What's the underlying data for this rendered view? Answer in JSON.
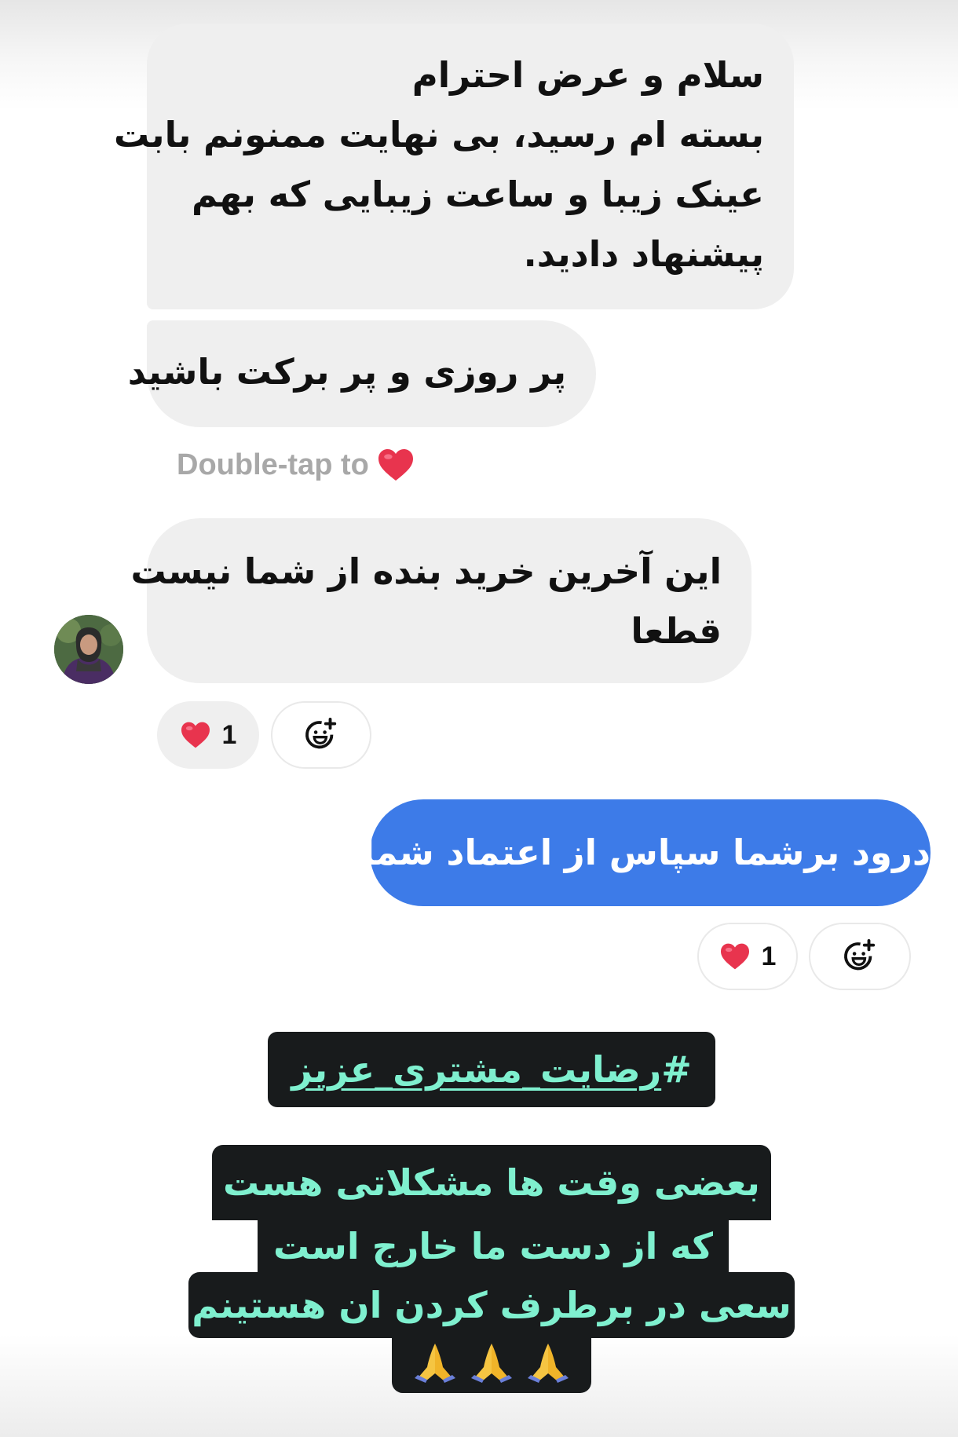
{
  "thread": {
    "messages": [
      {
        "sender": "other",
        "lines": [
          "سلام و عرض احترام",
          "بسته ام رسید، بی نهایت ممنونم بابت",
          "عینک زیبا و ساعت زیبایی که بهم",
          "پیشنهاد دادید."
        ]
      },
      {
        "sender": "other",
        "lines": [
          "پر روزی و پر برکت باشید"
        ]
      },
      {
        "sender": "other",
        "lines": [
          "این آخرین خرید بنده از شما نیست",
          "قطعا"
        ],
        "reaction_count": "1"
      },
      {
        "sender": "me",
        "text": "درود برشما سپاس از اعتماد شما",
        "reaction_count": "1"
      }
    ],
    "double_tap_hint": "Double-tap to",
    "reaction_icon": "heart-icon",
    "add_reaction_icon": "add-reaction-icon"
  },
  "overlay": {
    "hashtag_symbol": "#",
    "hashtag_text": "رضایت_مشتری_عزیز",
    "caption_lines": [
      "بعضی وقت ها مشکلاتی هست",
      "که از دست ما خارج است",
      "سعی در برطرف کردن ان هستینم"
    ],
    "emoji": "folded-hands-icon"
  },
  "colors": {
    "incoming_bubble": "#efefef",
    "outgoing_bubble": "#3d7be8",
    "caption_bg": "#181b1c",
    "caption_text": "#7ff0cf",
    "heart": "#e8344e"
  }
}
